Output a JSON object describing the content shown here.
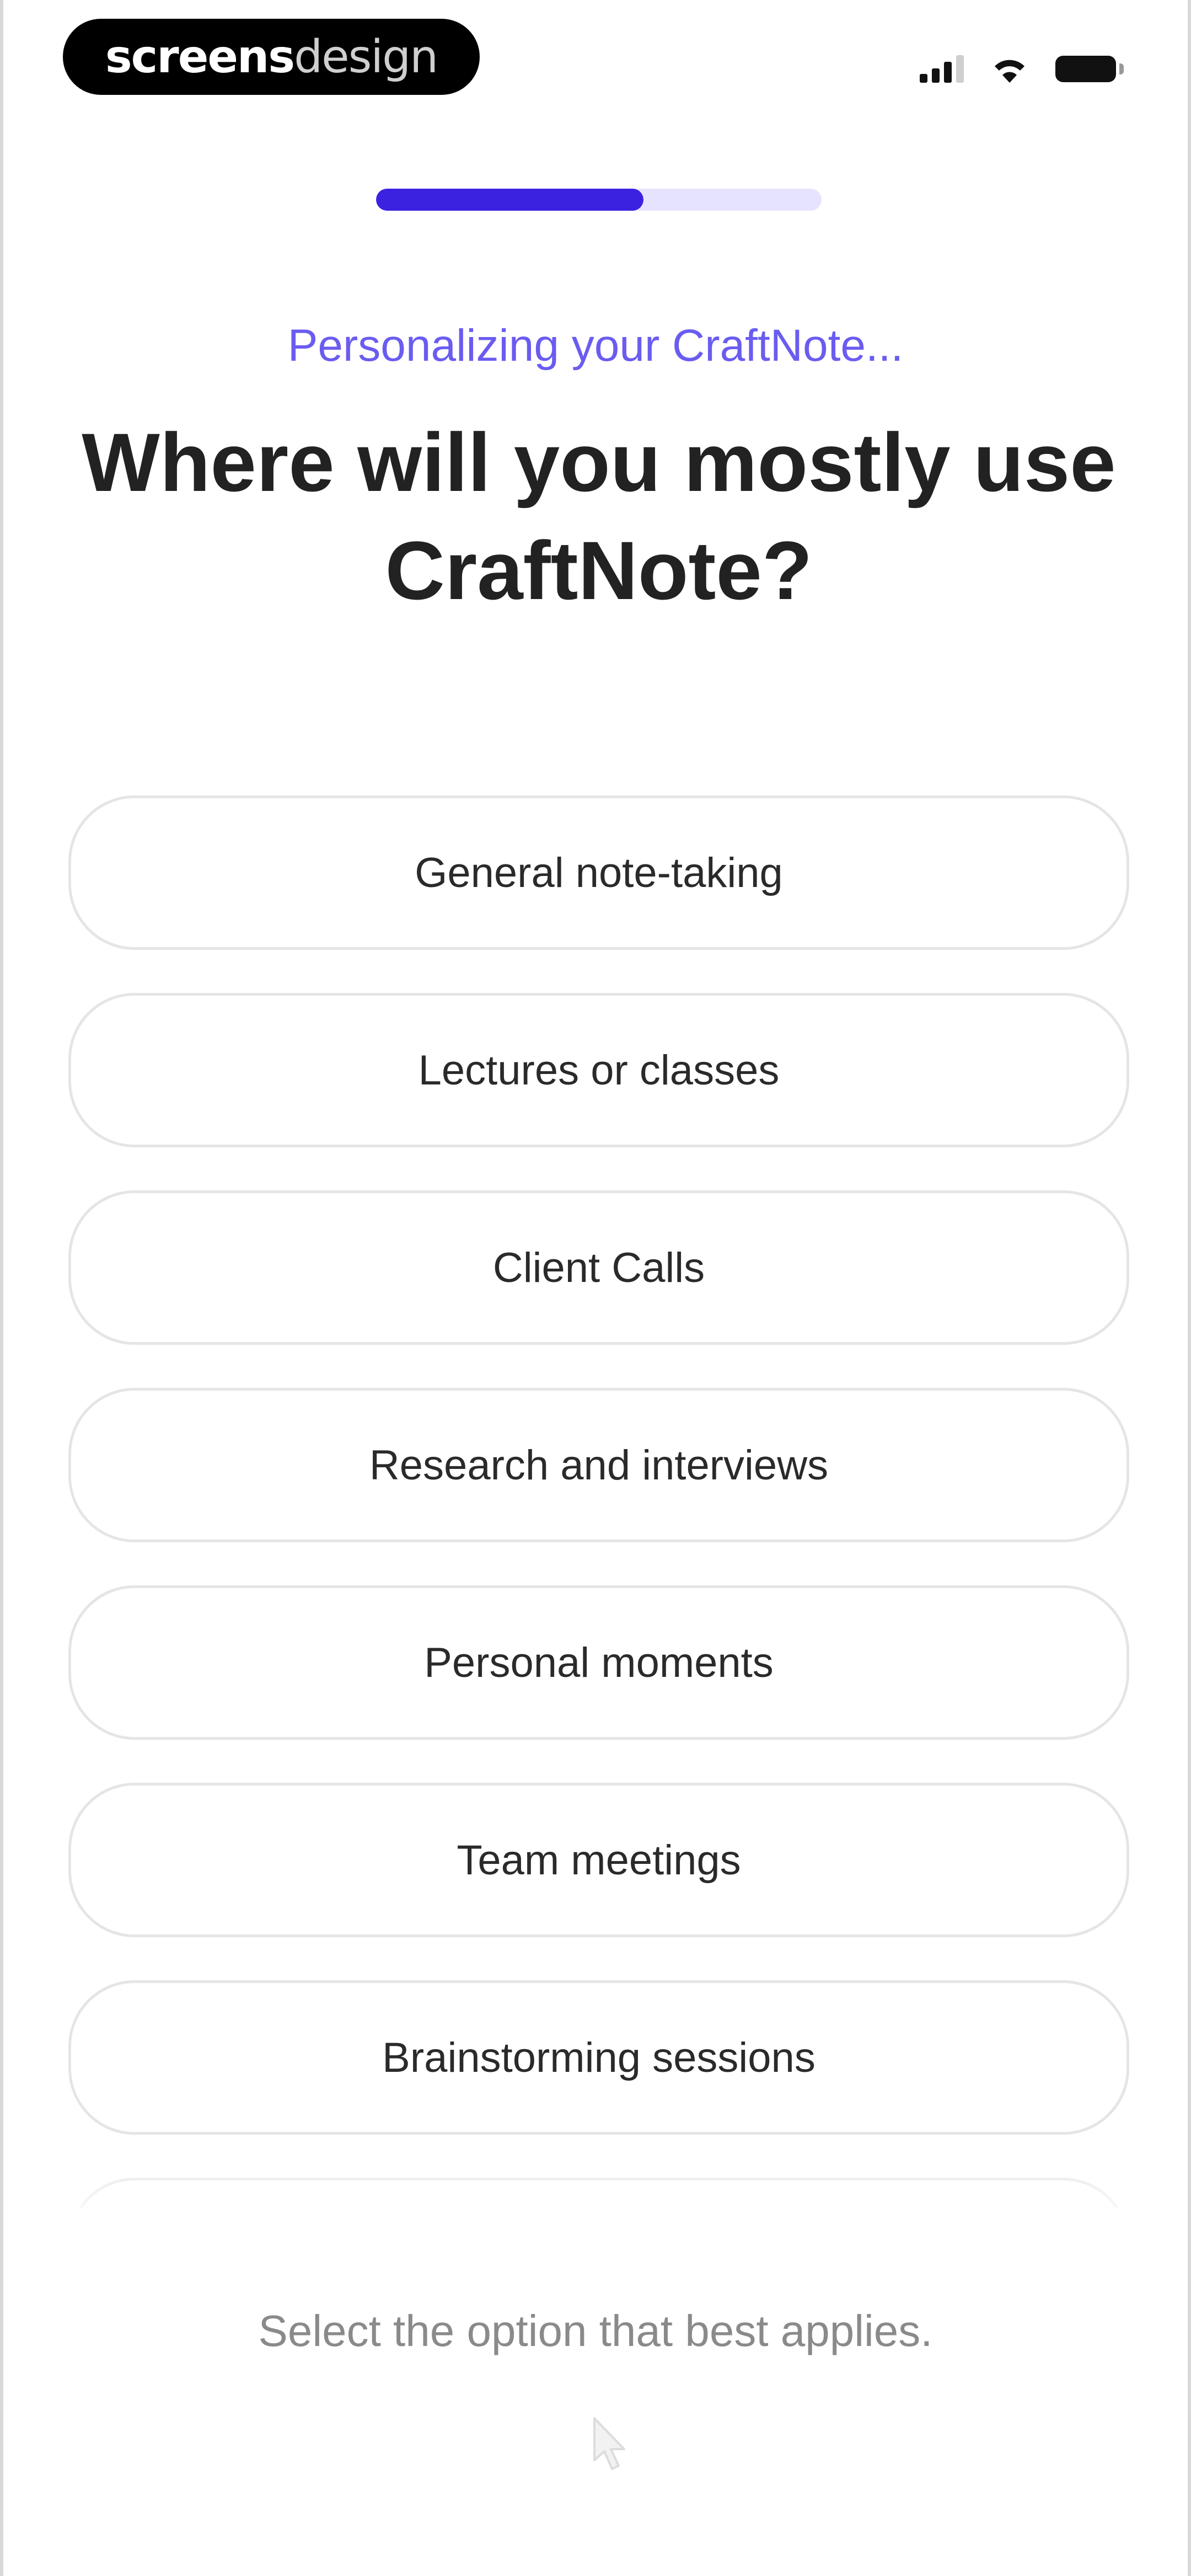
{
  "status_bar": {
    "brand_bold": "screens",
    "brand_light": "design",
    "icons": [
      "cellular-signal-icon",
      "wifi-icon",
      "battery-icon"
    ]
  },
  "progress": {
    "value": 0.6,
    "fill_color": "#3b22e0",
    "track_color": "#e6e3ff"
  },
  "header": {
    "eyebrow": "Personalizing your CraftNote...",
    "title": "Where will you mostly use CraftNote?"
  },
  "options": [
    {
      "label": "General note-taking"
    },
    {
      "label": "Lectures or classes"
    },
    {
      "label": "Client Calls"
    },
    {
      "label": "Research and interviews"
    },
    {
      "label": "Personal moments"
    },
    {
      "label": "Team meetings"
    },
    {
      "label": "Brainstorming sessions"
    },
    {
      "label": ""
    }
  ],
  "footer": {
    "hint": "Select the option that best applies."
  },
  "colors": {
    "accent": "#3b22e0",
    "eyebrow": "#6a5cf0",
    "option_border": "#e5e5e5"
  }
}
